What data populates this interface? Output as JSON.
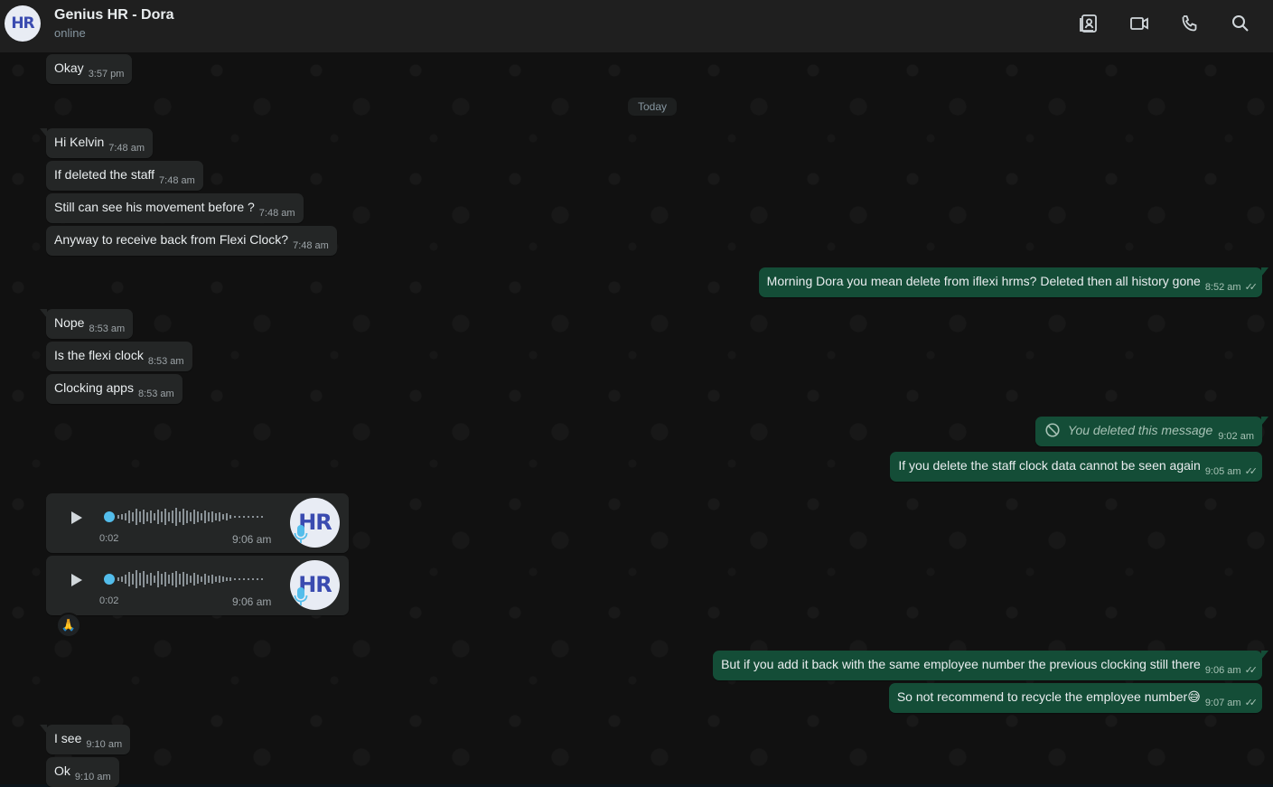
{
  "header": {
    "title": "Genius HR - Dora",
    "status": "online",
    "avatar_text": "HR",
    "icons": [
      "contact-card-icon",
      "video-call-icon",
      "phone-icon",
      "search-icon"
    ]
  },
  "date_divider": "Today",
  "messages": [
    {
      "id": "m0",
      "text": "Okay",
      "time": "3:57 pm"
    },
    {
      "id": "m1",
      "text": "Hi Kelvin",
      "time": "7:48 am"
    },
    {
      "id": "m2",
      "text": "If deleted the staff",
      "time": "7:48 am"
    },
    {
      "id": "m3",
      "text": "Still can see his movement before ?",
      "time": "7:48 am"
    },
    {
      "id": "m4",
      "text": "Anyway to receive back from Flexi Clock?",
      "time": "7:48 am"
    },
    {
      "id": "m5",
      "text": "Morning Dora you mean delete from iflexi hrms? Deleted then all history gone",
      "time": "8:52 am"
    },
    {
      "id": "m6",
      "text": "Nope",
      "time": "8:53 am"
    },
    {
      "id": "m7",
      "text": "Is the flexi clock",
      "time": "8:53 am"
    },
    {
      "id": "m8",
      "text": "Clocking apps",
      "time": "8:53 am"
    },
    {
      "id": "m9",
      "text": "You deleted this message",
      "time": "9:02 am"
    },
    {
      "id": "m10",
      "text": "If you delete the staff clock data cannot be seen again",
      "time": "9:05 am"
    },
    {
      "id": "m11",
      "text": "But if you add it back with the same employee number the previous clocking still there",
      "time": "9:06 am"
    },
    {
      "id": "m12",
      "text": "So not recommend to recycle the employee number",
      "emoji": "😅",
      "time": "9:07 am"
    },
    {
      "id": "m13",
      "text": "I see",
      "time": "9:10 am"
    },
    {
      "id": "m14",
      "text": "Ok",
      "time": "9:10 am"
    }
  ],
  "voice_notes": [
    {
      "duration": "0:02",
      "time": "9:06 am",
      "avatar_text": "HR"
    },
    {
      "duration": "0:02",
      "time": "9:06 am",
      "avatar_text": "HR"
    }
  ],
  "reaction": "🙏",
  "colors": {
    "incoming_bubble": "#242626",
    "outgoing_bubble": "#144d37",
    "header_bg": "#1f1f1f",
    "accent_blue": "#53bdeb"
  }
}
